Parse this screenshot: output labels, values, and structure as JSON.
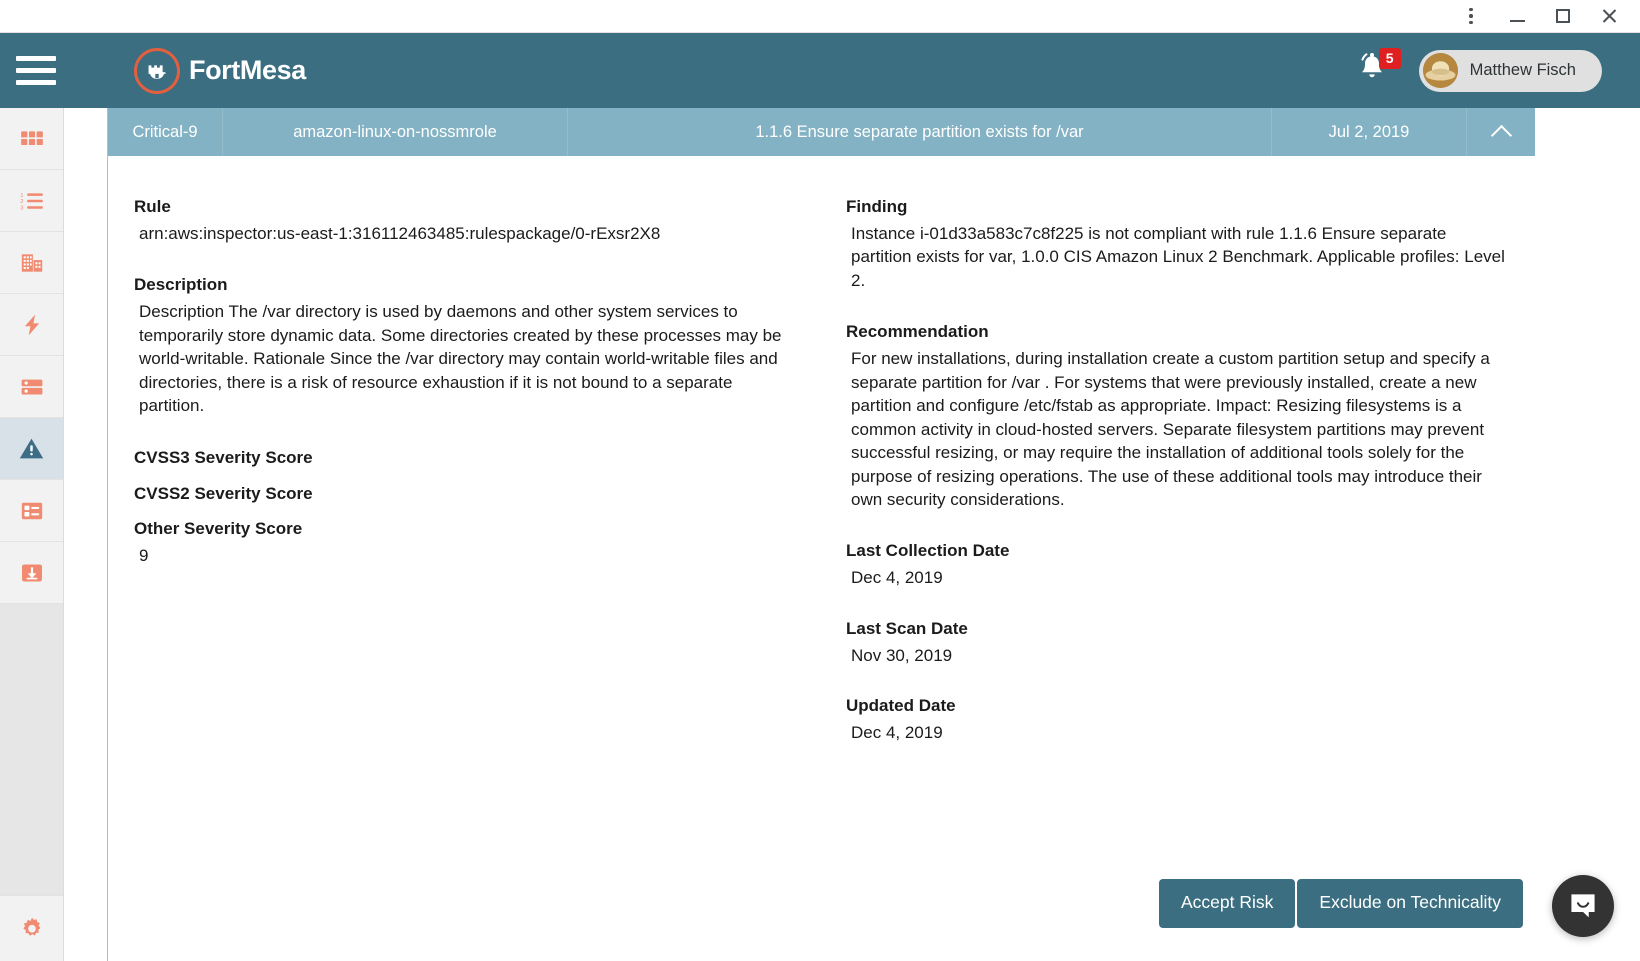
{
  "window": {
    "menu_label": "More options",
    "minimize_label": "Minimize",
    "maximize_label": "Maximize",
    "close_label": "Close"
  },
  "header": {
    "menu_label": "Menu",
    "brand": "FortMesa",
    "notification_count": "5",
    "user_name": "Matthew Fisch"
  },
  "sidebar": {
    "items": [
      {
        "icon": "dashboard-grid-icon",
        "label": "Dashboard",
        "active": false
      },
      {
        "icon": "ordered-list-icon",
        "label": "Tasks",
        "active": false
      },
      {
        "icon": "building-icon",
        "label": "Organizations",
        "active": false
      },
      {
        "icon": "lightning-bolt-icon",
        "label": "Activity",
        "active": false
      },
      {
        "icon": "server-icon",
        "label": "Assets",
        "active": false
      },
      {
        "icon": "warning-triangle-icon",
        "label": "Vulnerabilities",
        "active": true
      },
      {
        "icon": "checklist-icon",
        "label": "Assessments",
        "active": false
      },
      {
        "icon": "download-box-icon",
        "label": "Downloads",
        "active": false
      }
    ],
    "settings": {
      "icon": "gear-icon",
      "label": "Settings"
    }
  },
  "summary_bar": {
    "severity": "Critical-9",
    "asset": "amazon-linux-on-nossmrole",
    "rule_title": "1.1.6 Ensure separate partition exists for /var",
    "date": "Jul 2, 2019",
    "toggle_icon": "chevron-up-icon"
  },
  "detail": {
    "left": {
      "rule_label": "Rule",
      "rule_value": "arn:aws:inspector:us-east-1:316112463485:rulespackage/0-rExsr2X8",
      "description_label": "Description",
      "description_value": "Description The /var directory is used by daemons and other system services to temporarily store dynamic data. Some directories created by these processes may be world-writable. Rationale Since the /var directory may contain world-writable files and directories, there is a risk of resource exhaustion if it is not bound to a separate partition.",
      "cvss3_label": "CVSS3 Severity Score",
      "cvss3_value": "",
      "cvss2_label": "CVSS2 Severity Score",
      "cvss2_value": "",
      "other_label": "Other Severity Score",
      "other_value": "9"
    },
    "right": {
      "finding_label": "Finding",
      "finding_value": "Instance i-01d33a583c7c8f225 is not compliant with rule 1.1.6 Ensure separate partition exists for var, 1.0.0 CIS Amazon Linux 2 Benchmark. Applicable profiles: Level 2.",
      "recommendation_label": "Recommendation",
      "recommendation_value": "For new installations, during installation create a custom partition setup and specify a separate partition for /var . For systems that were previously installed, create a new partition and configure /etc/fstab as appropriate. Impact: Resizing filesystems is a common activity in cloud-hosted servers. Separate filesystem partitions may prevent successful resizing, or may require the installation of additional tools solely for the purpose of resizing operations. The use of these additional tools may introduce their own security considerations.",
      "last_collection_label": "Last Collection Date",
      "last_collection_value": "Dec 4, 2019",
      "last_scan_label": "Last Scan Date",
      "last_scan_value": "Nov 30, 2019",
      "updated_label": "Updated Date",
      "updated_value": "Dec 4, 2019"
    }
  },
  "actions": {
    "accept_risk": "Accept Risk",
    "exclude": "Exclude on Technicality"
  },
  "chat": {
    "icon": "chat-bubble-icon",
    "label": "Open chat"
  },
  "colors": {
    "header_teal": "#3a6e80",
    "summary_blue": "#82b2c3",
    "brand_orange": "#e2603f",
    "badge_red": "#e02020",
    "rail_bg": "#f2f2f2",
    "rail_active": "#d8e0e8"
  }
}
